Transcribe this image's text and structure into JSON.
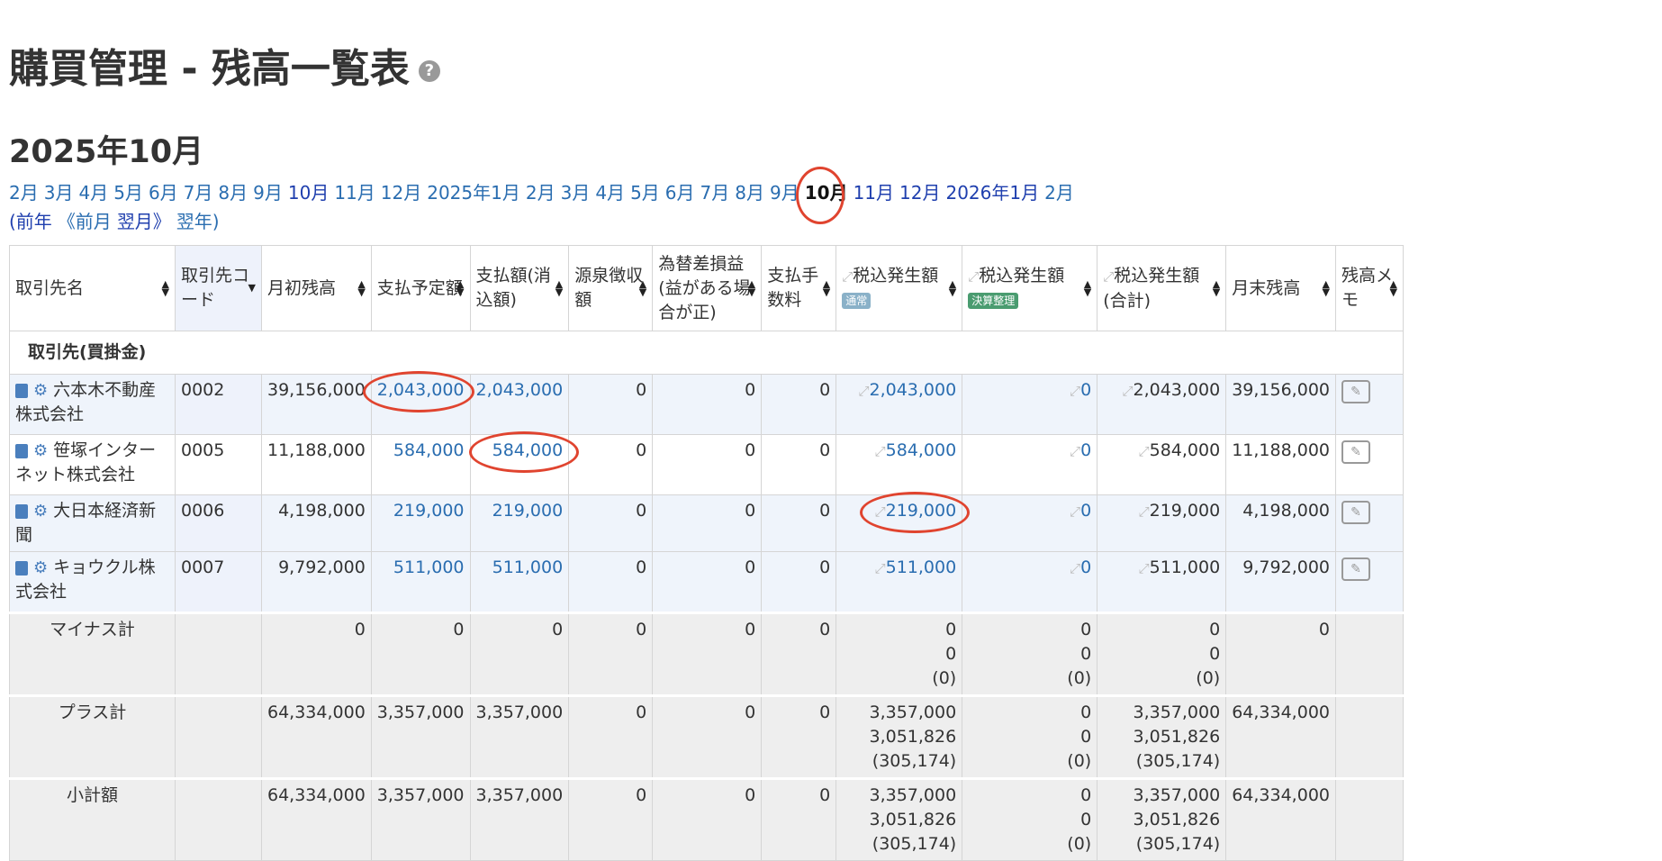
{
  "title": "購買管理 - 残高一覧表",
  "help_icon": "?",
  "period": "2025年10月",
  "months": {
    "items": [
      "2月",
      "3月",
      "4月",
      "5月",
      "6月",
      "7月",
      "8月",
      "9月",
      "10月",
      "11月",
      "12月",
      "2025年1月",
      "2月",
      "3月",
      "4月",
      "5月",
      "6月",
      "7月",
      "8月",
      "9月"
    ],
    "current": "10月",
    "after": [
      "11月",
      "12月",
      "2026年1月",
      "2月"
    ]
  },
  "nav": {
    "prev_year": "(前年",
    "prev_month": "《前月",
    "next_month": "翌月》",
    "next_year": "翌年)"
  },
  "table": {
    "headers": {
      "name": "取引先名",
      "code": "取引先コード",
      "opening": "月初残高",
      "planned": "支払予定額",
      "paid": "支払額(消込額)",
      "withholding": "源泉徴収額",
      "fx": "為替差損益(益がある場合が正)",
      "fee": "支払手数料",
      "tax_normal": "税込発生額",
      "tax_normal_badge": "通常",
      "tax_close": "税込発生額",
      "tax_close_badge": "決算整理",
      "tax_total": "税込発生額(合計)",
      "closing": "月末残高",
      "memo": "残高メモ"
    },
    "group_label": "取引先(買掛金)",
    "rows": [
      {
        "name": "六本木不動産株式会社",
        "code": "0002",
        "opening": "39,156,000",
        "planned": "2,043,000",
        "paid": "2,043,000",
        "withholding": "0",
        "fx": "0",
        "fee": "0",
        "tax_normal": "2,043,000",
        "tax_close": "0",
        "tax_total": "2,043,000",
        "closing": "39,156,000"
      },
      {
        "name": "笹塚インターネット株式会社",
        "code": "0005",
        "opening": "11,188,000",
        "planned": "584,000",
        "paid": "584,000",
        "withholding": "0",
        "fx": "0",
        "fee": "0",
        "tax_normal": "584,000",
        "tax_close": "0",
        "tax_total": "584,000",
        "closing": "11,188,000"
      },
      {
        "name": "大日本経済新聞",
        "code": "0006",
        "opening": "4,198,000",
        "planned": "219,000",
        "paid": "219,000",
        "withholding": "0",
        "fx": "0",
        "fee": "0",
        "tax_normal": "219,000",
        "tax_close": "0",
        "tax_total": "219,000",
        "closing": "4,198,000"
      },
      {
        "name": "キョウクル株式会社",
        "code": "0007",
        "opening": "9,792,000",
        "planned": "511,000",
        "paid": "511,000",
        "withholding": "0",
        "fx": "0",
        "fee": "0",
        "tax_normal": "511,000",
        "tax_close": "0",
        "tax_total": "511,000",
        "closing": "9,792,000"
      }
    ],
    "minus": {
      "label": "マイナス計",
      "opening": "0",
      "planned": "0",
      "paid": "0",
      "withholding": "0",
      "fx": "0",
      "fee": "0",
      "tax_normal": [
        "0",
        "0",
        "(0)"
      ],
      "tax_close": [
        "0",
        "0",
        "(0)"
      ],
      "tax_total": [
        "0",
        "0",
        "(0)"
      ],
      "closing": "0"
    },
    "plus": {
      "label": "プラス計",
      "opening": "64,334,000",
      "planned": "3,357,000",
      "paid": "3,357,000",
      "withholding": "0",
      "fx": "0",
      "fee": "0",
      "tax_normal": [
        "3,357,000",
        "3,051,826",
        "(305,174)"
      ],
      "tax_close": [
        "0",
        "0",
        "(0)"
      ],
      "tax_total": [
        "3,357,000",
        "3,051,826",
        "(305,174)"
      ],
      "closing": "64,334,000"
    },
    "subtotal": {
      "label": "小計額",
      "opening": "64,334,000",
      "planned": "3,357,000",
      "paid": "3,357,000",
      "withholding": "0",
      "fx": "0",
      "fee": "0",
      "tax_normal": [
        "3,357,000",
        "3,051,826",
        "(305,174)"
      ],
      "tax_close": [
        "0",
        "0",
        "(0)"
      ],
      "tax_total": [
        "3,357,000",
        "3,051,826",
        "(305,174)"
      ],
      "closing": "64,334,000"
    }
  },
  "colors": {
    "link": "#2a6db0",
    "annotation": "#e0442f",
    "badge_normal": "#8ab1c8",
    "badge_close": "#4a9c70"
  }
}
